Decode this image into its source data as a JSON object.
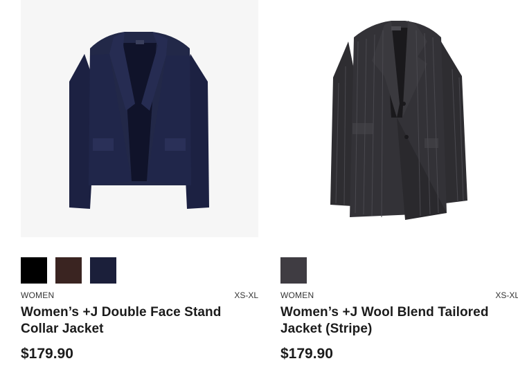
{
  "products": [
    {
      "image_alt": "navy-stand-collar-jacket",
      "colors": [
        "#000000",
        "#3a2421",
        "#1b1f3a"
      ],
      "category": "WOMEN",
      "sizes": "XS-XL",
      "title": "Women’s +J Double Face Stand Collar Jacket",
      "price": "$179.90"
    },
    {
      "image_alt": "gray-striped-tailored-jacket",
      "colors": [
        "#3f3c42"
      ],
      "category": "WOMEN",
      "sizes": "XS-XL",
      "title": "Women’s +J Wool Blend Tailored Jacket (Stripe)",
      "price": "$179.90"
    }
  ]
}
